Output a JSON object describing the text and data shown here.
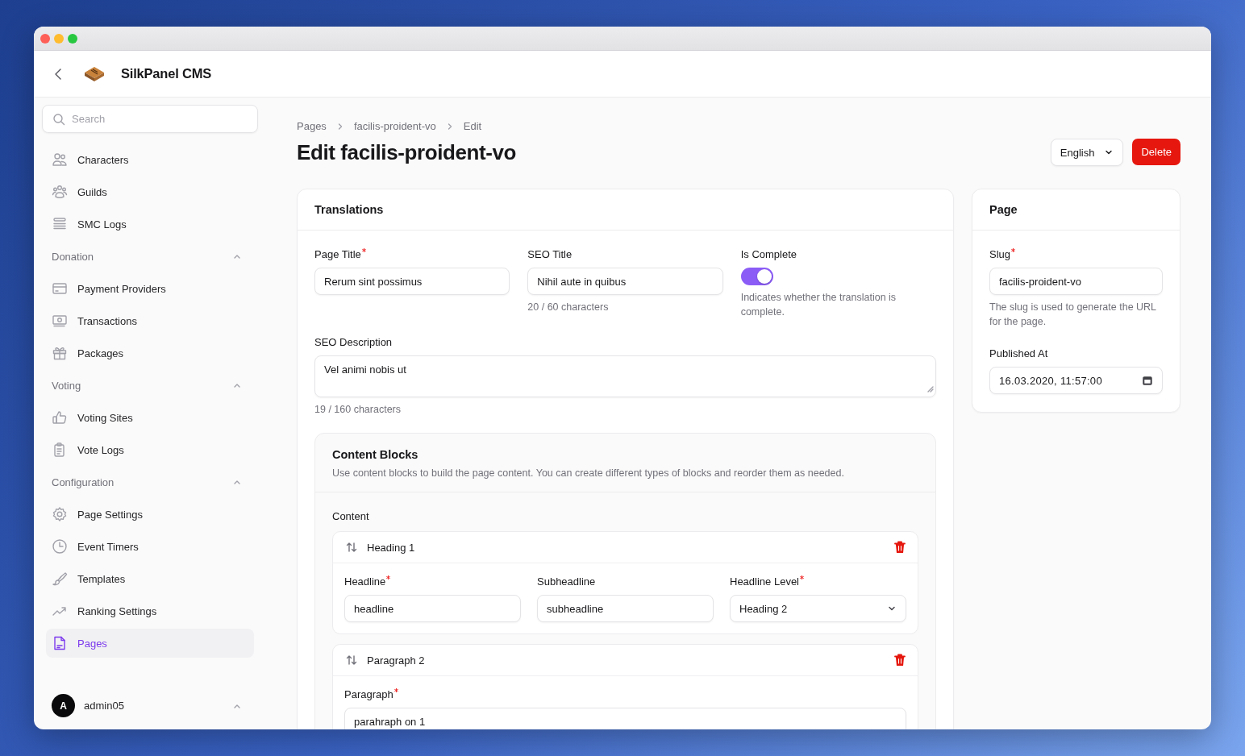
{
  "window": {
    "app_title": "SilkPanel CMS"
  },
  "sidebar": {
    "search": {
      "placeholder": "Search"
    },
    "groups": [
      {
        "items": [
          {
            "label": "Characters",
            "selected": false
          },
          {
            "label": "Guilds",
            "selected": false
          },
          {
            "label": "SMC Logs",
            "selected": false
          }
        ]
      },
      {
        "label": "Donation",
        "expanded": true,
        "items": [
          {
            "label": "Payment Providers",
            "selected": false
          },
          {
            "label": "Transactions",
            "selected": false
          },
          {
            "label": "Packages",
            "selected": false
          }
        ]
      },
      {
        "label": "Voting",
        "expanded": true,
        "items": [
          {
            "label": "Voting Sites",
            "selected": false
          },
          {
            "label": "Vote Logs",
            "selected": false
          }
        ]
      },
      {
        "label": "Configuration",
        "expanded": true,
        "items": [
          {
            "label": "Page Settings",
            "selected": false
          },
          {
            "label": "Event Timers",
            "selected": false
          },
          {
            "label": "Templates",
            "selected": false
          },
          {
            "label": "Ranking Settings",
            "selected": false
          },
          {
            "label": "Pages",
            "selected": true
          }
        ]
      }
    ],
    "user": {
      "initial": "A",
      "name": "admin05"
    }
  },
  "breadcrumbs": [
    "Pages",
    "facilis-proident-vo",
    "Edit"
  ],
  "page_title": "Edit facilis-proident-vo",
  "language_select": {
    "value": "English"
  },
  "delete_button": "Delete",
  "translations": {
    "title": "Translations",
    "fields": [
      {
        "kind": "text",
        "label": "Page Title",
        "required": true,
        "value": "Rerum sint possimus"
      },
      {
        "kind": "text",
        "label": "SEO Title",
        "required": false,
        "value": "Nihil aute in quibus",
        "hint": "20 / 60 characters"
      },
      {
        "kind": "toggle",
        "label": "Is Complete",
        "required": false,
        "on": true,
        "hint": "Indicates whether the translation is complete."
      }
    ],
    "seo_description": {
      "label": "SEO Description",
      "value": "Vel animi nobis ut",
      "hint": "19 / 160 characters"
    },
    "content_blocks": {
      "title": "Content Blocks",
      "description": "Use content blocks to build the page content. You can create different types of blocks and reorder them as needed.",
      "label": "Content",
      "blocks": [
        {
          "title": "Heading 1",
          "fields": [
            {
              "kind": "text",
              "label": "Headline",
              "required": true,
              "value": "headline"
            },
            {
              "kind": "text",
              "label": "Subheadline",
              "required": false,
              "value": "subheadline"
            },
            {
              "kind": "select",
              "label": "Headline Level",
              "required": true,
              "value": "Heading 2"
            }
          ]
        },
        {
          "title": "Paragraph 2",
          "fields": [
            {
              "kind": "text",
              "label": "Paragraph",
              "required": true,
              "value": "parahraph on 1"
            }
          ]
        }
      ]
    }
  },
  "page_card": {
    "title": "Page",
    "fields": [
      {
        "kind": "text",
        "label": "Slug",
        "required": true,
        "value": "facilis-proident-vo",
        "hint": "The slug is used to generate the URL for the page."
      },
      {
        "kind": "datetime",
        "label": "Published At",
        "required": false,
        "value": "16.03.2020, 11:57:00"
      }
    ]
  }
}
